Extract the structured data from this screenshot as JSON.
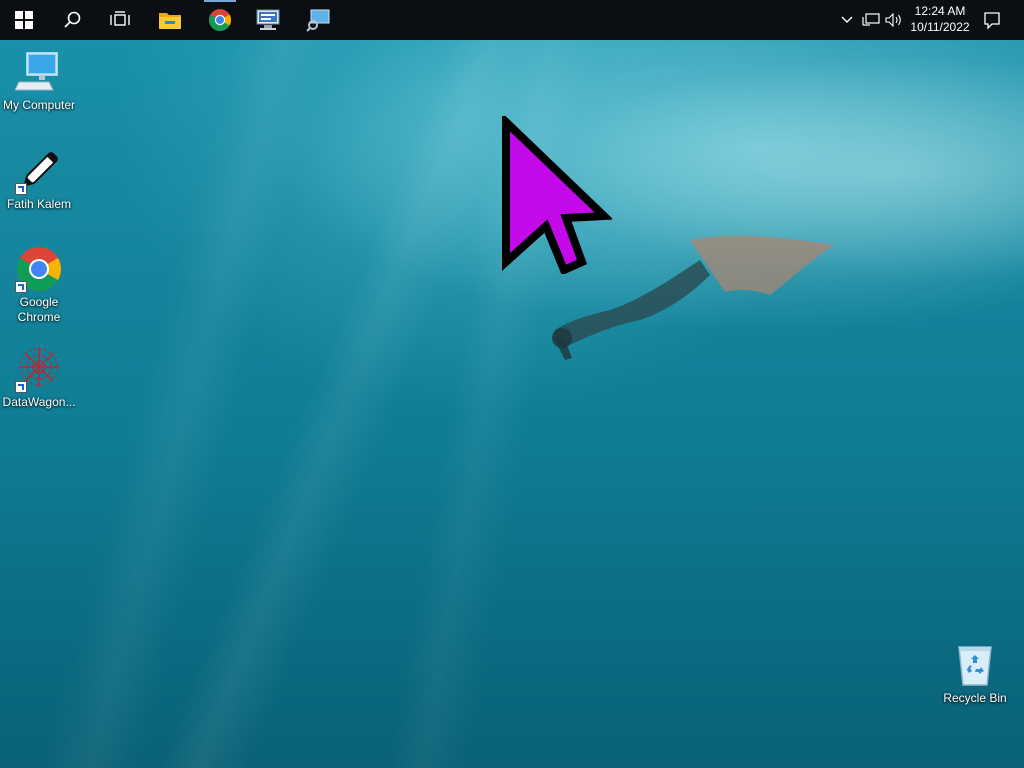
{
  "taskbar": {
    "pinned": [
      {
        "name": "start-button",
        "icon": "windows-logo-icon"
      },
      {
        "name": "search-button",
        "icon": "search-icon"
      },
      {
        "name": "task-view-button",
        "icon": "task-view-icon"
      },
      {
        "name": "file-explorer-button",
        "icon": "folder-icon"
      },
      {
        "name": "chrome-button",
        "icon": "chrome-icon"
      },
      {
        "name": "network-app-button",
        "icon": "network-computer-icon"
      },
      {
        "name": "remote-app-button",
        "icon": "monitor-search-icon"
      }
    ],
    "tray": {
      "chevron": "chevron-up-icon",
      "network": "network-icon",
      "volume": "volume-icon",
      "notifications": "action-center-icon"
    },
    "clock": {
      "time": "12:24 AM",
      "date": "10/11/2022"
    }
  },
  "desktop": {
    "icons": [
      {
        "label": "My Computer",
        "icon": "computer-icon",
        "shortcut": false
      },
      {
        "label": "Fatih Kalem",
        "icon": "pen-icon",
        "shortcut": true
      },
      {
        "label": "Google Chrome",
        "icon": "chrome-icon",
        "shortcut": true
      },
      {
        "label": "DataWagon...",
        "icon": "datawagon-icon",
        "shortcut": true
      },
      {
        "label": "Recycle Bin",
        "icon": "recycle-bin-icon",
        "shortcut": false
      }
    ]
  },
  "colors": {
    "taskbar": "#0b0f13",
    "cursor": "#c40ae8",
    "accent": "#7aa7d9"
  }
}
